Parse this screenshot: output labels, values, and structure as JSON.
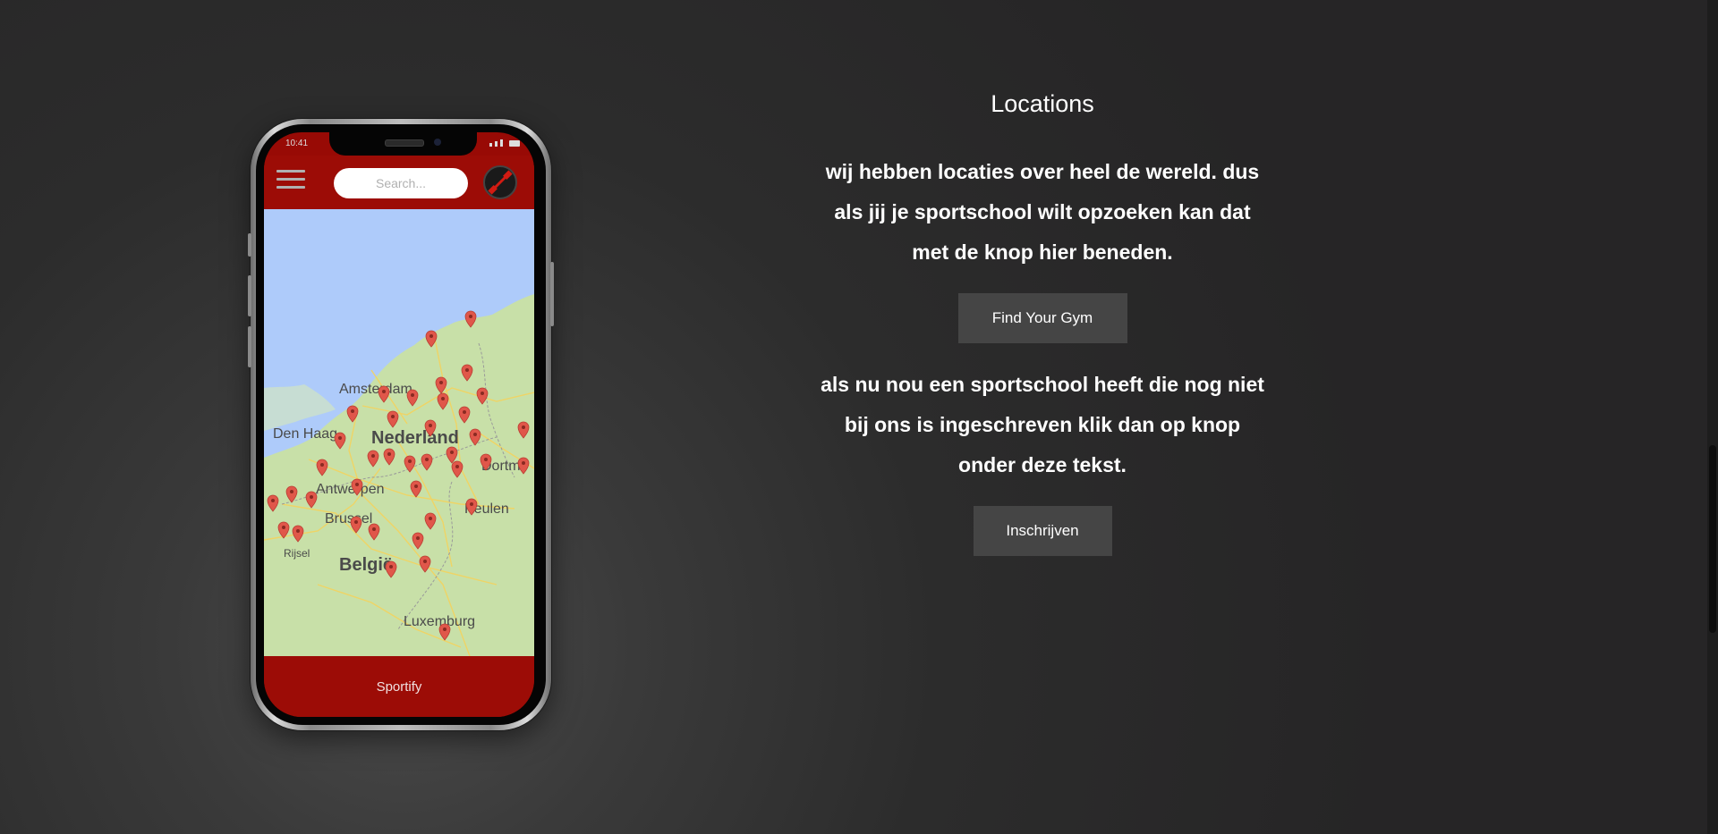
{
  "phone": {
    "status_time": "10:41",
    "search_placeholder": "Search...",
    "footer_title": "Sportify",
    "map_labels": {
      "amsterdam": "Amsterdam",
      "den_haag": "Den Haag",
      "nederland": "Nederland",
      "dortmund": "Dortm",
      "antwerpen": "Antwerpen",
      "keulen": "Keulen",
      "brussel": "Brussel",
      "rijsel": "Rijsel",
      "belgie": "België",
      "luxemburg": "Luxemburg"
    },
    "accent_color": "#9c0c06",
    "pin_color": "#e0574a"
  },
  "content": {
    "heading": "Locations",
    "paragraph_1_lines": [
      "wij hebben locaties over heel de wereld. dus",
      "als jij je sportschool wilt opzoeken kan dat",
      "met de knop hier beneden."
    ],
    "find_button": "Find Your Gym",
    "paragraph_2_lines": [
      "als nu nou een sportschool heeft die nog niet",
      "bij ons is ingeschreven klik dan op knop",
      "onder deze tekst."
    ],
    "join_button": "Inschrijven"
  }
}
